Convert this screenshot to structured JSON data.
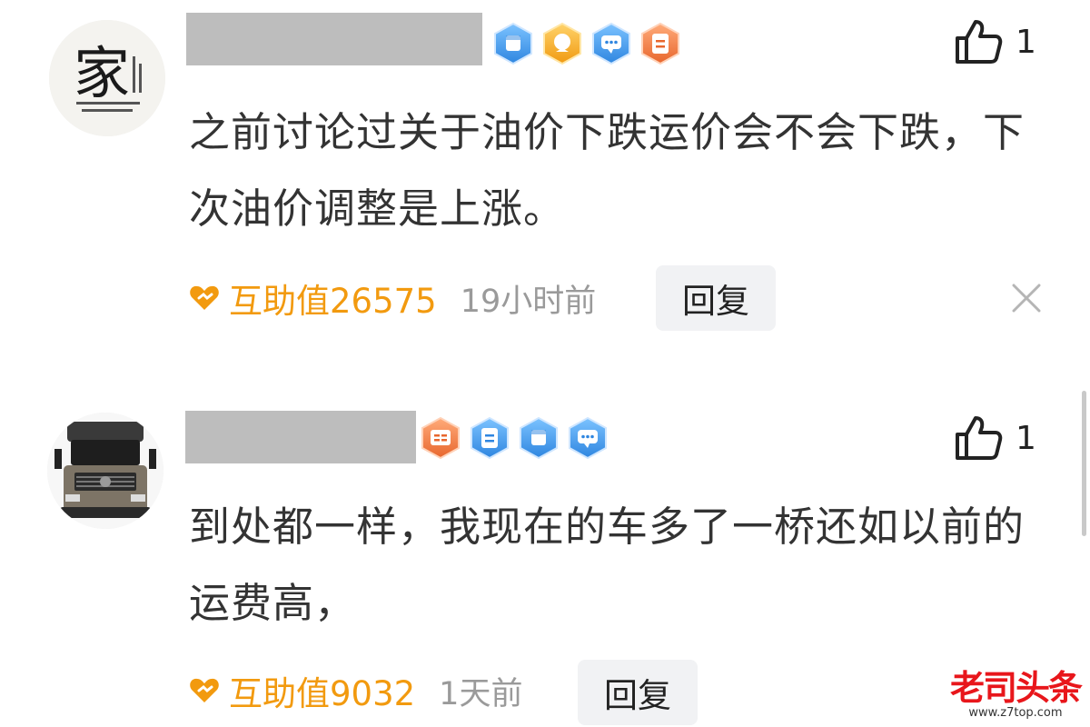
{
  "comments": [
    {
      "avatar_icon": "calligraphy-avatar-icon",
      "avatar_glyph": "家",
      "badges": [
        "fist-badge-icon",
        "medal-badge-icon",
        "chat-badge-icon",
        "doc-badge-icon"
      ],
      "like_count": "1",
      "text": "之前讨论过关于油价下跌运价会不会下跌，下次油价调整是上涨。",
      "help_value": "互助值26575",
      "time": "19小时前",
      "reply_label": "回复"
    },
    {
      "avatar_icon": "truck-avatar-icon",
      "badges": [
        "doc-badge-icon",
        "note-badge-icon",
        "fist-badge-icon",
        "chat-badge-icon"
      ],
      "like_count": "1",
      "text": "到处都一样，我现在的车多了一桥还如以前的运费高，",
      "help_value": "互助值9032",
      "time": "1天前",
      "reply_label": "回复"
    }
  ],
  "watermark": {
    "main": "老司头条",
    "sub": "www.z7top.com"
  },
  "colors": {
    "help": "#f29a0f",
    "time": "#9a9a9a",
    "reply_bg": "#f1f2f4",
    "watermark": "#e8161b"
  }
}
